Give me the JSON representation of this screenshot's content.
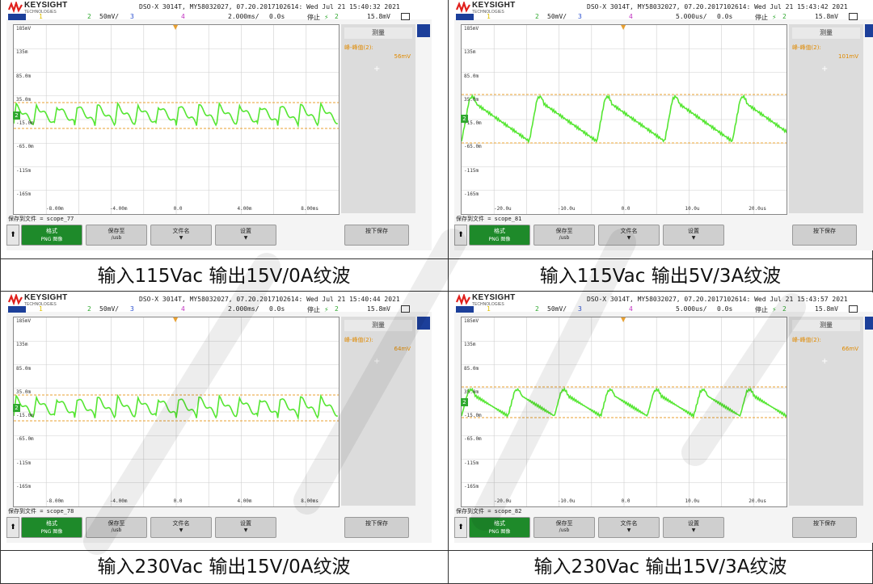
{
  "panels": [
    {
      "id": "p1",
      "brand": "KEYSIGHT",
      "brand_sub": "TECHNOLOGIES",
      "model": "DSO-X 3014T, MY58032027, 07.20.2017102614: Wed Jul 21 15:40:32 2021",
      "status": {
        "ch1": "1",
        "ch2": "2",
        "ch2_scale": "50mV/",
        "ch3": "3",
        "ch4": "4",
        "timebase": "2.000ms/",
        "delay": "0.0s",
        "state": "停止",
        "trig_ch": "2",
        "trig_level": "15.8mV"
      },
      "y_labels": [
        "185mV",
        "135m",
        "85.0m",
        "35.0m",
        "-15.0m",
        "-65.0m",
        "-115m",
        "-165m"
      ],
      "x_labels": [
        "-8.00m",
        "-4.00m",
        "0.0",
        "4.00m",
        "8.00ms"
      ],
      "measure_header": "测量",
      "measure_label": "峰-峰值(2):",
      "measure_value": "56mV",
      "save_to": "保存到文件 = scope_77",
      "softkeys": {
        "arrow": "⬆",
        "format_label": "格式",
        "format_value": "PNG 图像",
        "save_to_label": "保存至",
        "save_to_value": "/usb",
        "filename": "文件名",
        "settings": "设置",
        "save": "按下保存"
      },
      "wave": "fast"
    },
    {
      "id": "p2",
      "brand": "KEYSIGHT",
      "brand_sub": "TECHNOLOGIES",
      "model": "DSO-X 3014T, MY58032027, 07.20.2017102614: Wed Jul 21 15:43:42 2021",
      "status": {
        "ch1": "1",
        "ch2": "2",
        "ch2_scale": "50mV/",
        "ch3": "3",
        "ch4": "4",
        "timebase": "5.000us/",
        "delay": "0.0s",
        "state": "停止",
        "trig_ch": "2",
        "trig_level": "15.8mV"
      },
      "y_labels": [
        "185mV",
        "135m",
        "85.0m",
        "35.0m",
        "-15.0m",
        "-65.0m",
        "-115m",
        "-165m"
      ],
      "x_labels": [
        "-20.0u",
        "-10.0u",
        "0.0",
        "10.0u",
        "20.0us"
      ],
      "measure_header": "测量",
      "measure_label": "峰-峰值(2):",
      "measure_value": "101mV",
      "save_to": "保存到文件 = scope_81",
      "softkeys": {
        "arrow": "⬆",
        "format_label": "格式",
        "format_value": "PNG 图像",
        "save_to_label": "保存至",
        "save_to_value": "/usb",
        "filename": "文件名",
        "settings": "设置",
        "save": "按下保存"
      },
      "wave": "slow-big"
    },
    {
      "id": "p3",
      "brand": "KEYSIGHT",
      "brand_sub": "TECHNOLOGIES",
      "model": "DSO-X 3014T, MY58032027, 07.20.2017102614: Wed Jul 21 15:40:44 2021",
      "status": {
        "ch1": "1",
        "ch2": "2",
        "ch2_scale": "50mV/",
        "ch3": "3",
        "ch4": "4",
        "timebase": "2.000ms/",
        "delay": "0.0s",
        "state": "停止",
        "trig_ch": "2",
        "trig_level": "15.8mV"
      },
      "y_labels": [
        "185mV",
        "135m",
        "85.0m",
        "35.0m",
        "-15.0m",
        "-65.0m",
        "-115m",
        "-165m"
      ],
      "x_labels": [
        "-8.00m",
        "-4.00m",
        "0.0",
        "4.00m",
        "8.00ms"
      ],
      "measure_header": "测量",
      "measure_label": "峰-峰值(2):",
      "measure_value": "64mV",
      "save_to": "保存到文件 = scope_78",
      "softkeys": {
        "arrow": "⬆",
        "format_label": "格式",
        "format_value": "PNG 图像",
        "save_to_label": "保存至",
        "save_to_value": "/usb",
        "filename": "文件名",
        "settings": "设置",
        "save": "按下保存"
      },
      "wave": "fast"
    },
    {
      "id": "p4",
      "brand": "KEYSIGHT",
      "brand_sub": "TECHNOLOGIES",
      "model": "DSO-X 3014T, MY58032027, 07.20.2017102614: Wed Jul 21 15:43:57 2021",
      "status": {
        "ch1": "1",
        "ch2": "2",
        "ch2_scale": "50mV/",
        "ch3": "3",
        "ch4": "4",
        "timebase": "5.000us/",
        "delay": "0.0s",
        "state": "停止",
        "trig_ch": "2",
        "trig_level": "15.8mV"
      },
      "y_labels": [
        "185mV",
        "135m",
        "85.0m",
        "35.0m",
        "-15.0m",
        "-65.0m",
        "-115m",
        "-165m"
      ],
      "x_labels": [
        "-20.0u",
        "-10.0u",
        "0.0",
        "10.0u",
        "20.0us"
      ],
      "measure_header": "测量",
      "measure_label": "峰-峰值(2):",
      "measure_value": "66mV",
      "save_to": "保存到文件 = scope_82",
      "softkeys": {
        "arrow": "⬆",
        "format_label": "格式",
        "format_value": "PNG 图像",
        "save_to_label": "保存至",
        "save_to_value": "/usb",
        "filename": "文件名",
        "settings": "设置",
        "save": "按下保存"
      },
      "wave": "slow-small"
    }
  ],
  "captions": [
    "输入115Vac 输出15V/0A纹波",
    "输入115Vac 输出5V/3A纹波",
    "输入230Vac 输出15V/0A纹波",
    "输入230Vac 输出15V/3A纹波"
  ],
  "colors": {
    "trace": "#55e632",
    "marker": "#e8a030",
    "brand_blue": "#1c3f9a",
    "softkey_green": "#1e8a2a",
    "logo_red": "#e0201c"
  }
}
